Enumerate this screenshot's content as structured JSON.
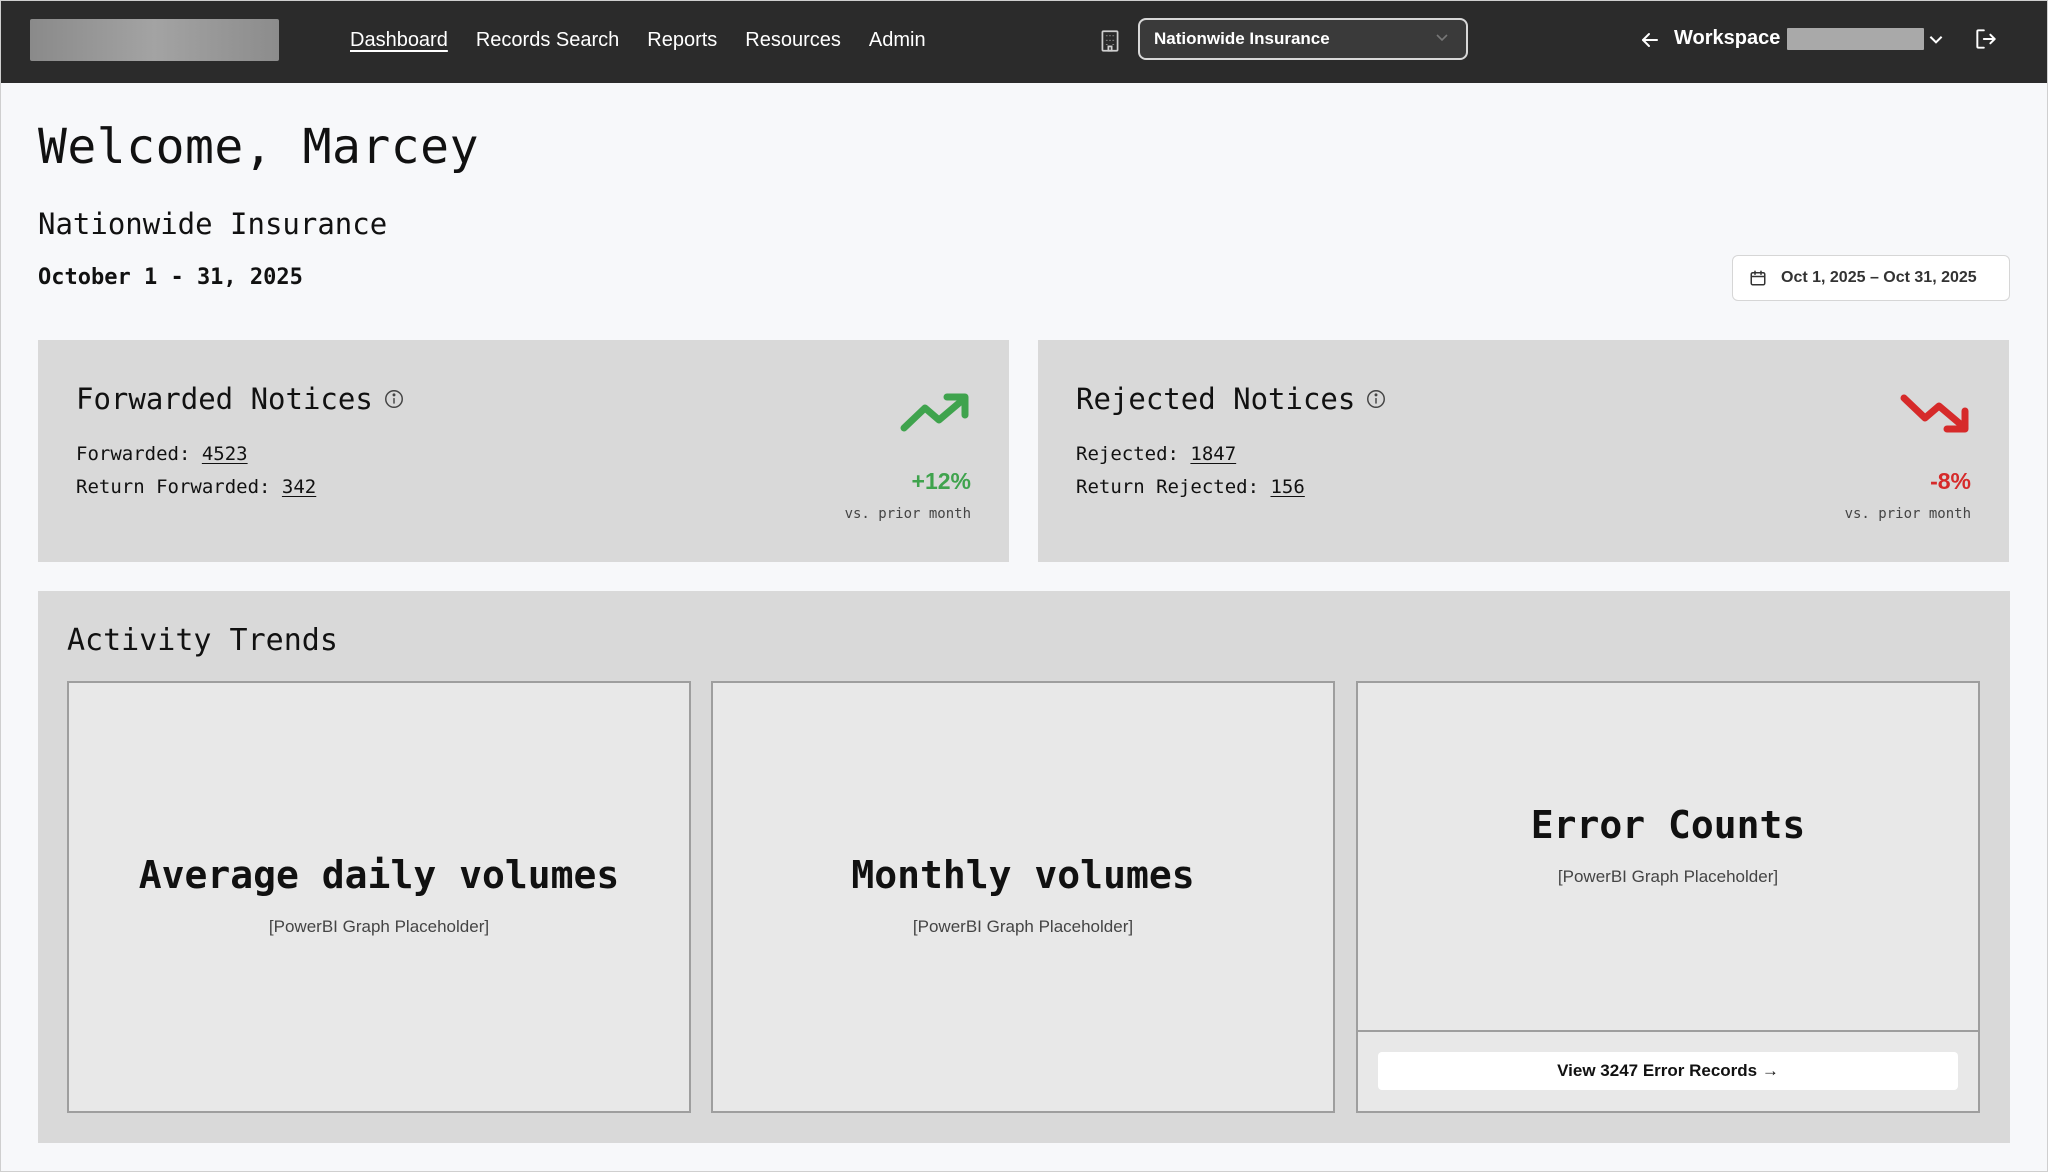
{
  "nav": {
    "items": [
      {
        "label": "Dashboard",
        "active": true
      },
      {
        "label": "Records Search",
        "active": false
      },
      {
        "label": "Reports",
        "active": false
      },
      {
        "label": "Resources",
        "active": false
      },
      {
        "label": "Admin",
        "active": false
      }
    ],
    "org_select": "Nationwide Insurance",
    "workspace_label": "Workspace"
  },
  "header": {
    "welcome": "Welcome, Marcey",
    "org_name": "Nationwide Insurance",
    "period": "October 1 - 31, 2025",
    "date_range": "Oct 1, 2025 – Oct 31, 2025"
  },
  "forwarded": {
    "title": "Forwarded Notices",
    "line1_label": "Forwarded:",
    "line1_value": "4523",
    "line2_label": "Return Forwarded:",
    "line2_value": "342",
    "change": "+12%",
    "change_caption": "vs. prior month",
    "trend_color": "#3fa34d"
  },
  "rejected": {
    "title": "Rejected Notices",
    "line1_label": "Rejected:",
    "line1_value": "1847",
    "line2_label": "Return Rejected:",
    "line2_value": "156",
    "change": "-8%",
    "change_caption": "vs. prior month",
    "trend_color": "#d62a2a"
  },
  "activity": {
    "title": "Activity Trends",
    "panels": [
      {
        "title": "Average daily volumes",
        "subtitle": "[PowerBI Graph Placeholder]"
      },
      {
        "title": "Monthly volumes",
        "subtitle": "[PowerBI Graph Placeholder]"
      },
      {
        "title": "Error Counts",
        "subtitle": "[PowerBI Graph Placeholder]"
      }
    ],
    "error_button": "View 3247 Error Records →"
  }
}
